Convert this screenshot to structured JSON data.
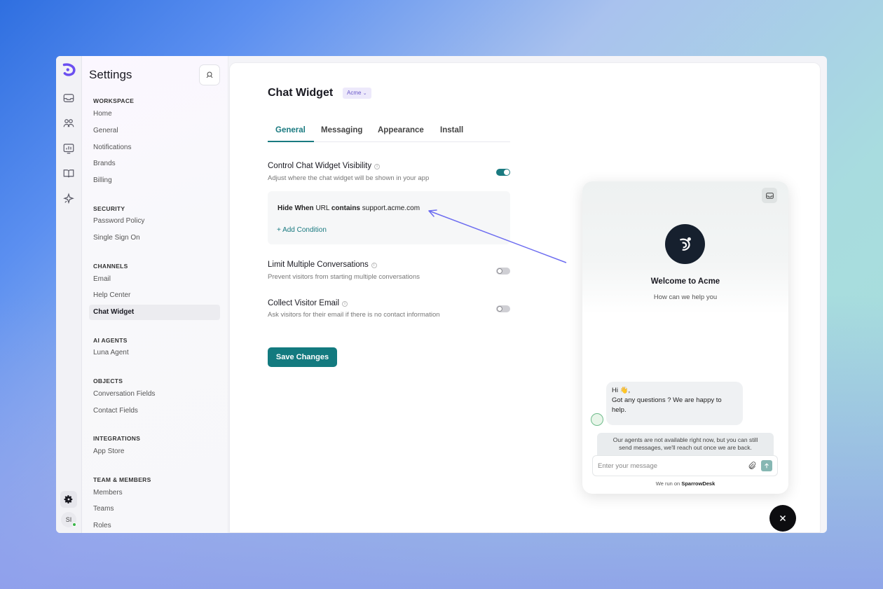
{
  "sidebar": {
    "title": "Settings",
    "sections": {
      "workspace": {
        "label": "WORKSPACE",
        "items": [
          "Home",
          "General",
          "Notifications",
          "Brands",
          "Billing"
        ]
      },
      "security": {
        "label": "SECURITY",
        "items": [
          "Password Policy",
          "Single Sign On"
        ]
      },
      "channels": {
        "label": "CHANNELS",
        "items": [
          "Email",
          "Help Center",
          "Chat Widget"
        ]
      },
      "ai_agents": {
        "label": "AI AGENTS",
        "items": [
          "Luna Agent"
        ]
      },
      "objects": {
        "label": "OBJECTS",
        "items": [
          "Conversation Fields",
          "Contact Fields"
        ]
      },
      "integrations": {
        "label": "INTEGRATIONS",
        "items": [
          "App Store"
        ]
      },
      "team": {
        "label": "TEAM & MEMBERS",
        "items": [
          "Members",
          "Teams",
          "Roles"
        ]
      }
    },
    "active_item": "Chat Widget"
  },
  "rail": {
    "avatar_initials": "SI"
  },
  "main": {
    "title": "Chat Widget",
    "brand_badge": "Acme",
    "tabs": [
      "General",
      "Messaging",
      "Appearance",
      "Install"
    ],
    "active_tab": "General",
    "visibility": {
      "title": "Control Chat Widget Visibility",
      "desc": "Adjust where the chat widget will be shown in your app",
      "enabled": true
    },
    "condition": {
      "hide_when": "Hide When",
      "field": "URL",
      "operator": "contains",
      "value": "support.acme.com",
      "add_label": "+ Add Condition"
    },
    "limit_conversations": {
      "title": "Limit Multiple Conversations",
      "desc": "Prevent visitors from starting multiple conversations",
      "enabled": false
    },
    "collect_email": {
      "title": "Collect Visitor Email",
      "desc": "Ask visitors for their email if there is no contact information",
      "enabled": false
    },
    "save_label": "Save Changes"
  },
  "widget": {
    "welcome": "Welcome to Acme",
    "help": "How can we help you",
    "bubble_line1": "Hi 👋,",
    "bubble_line2": "Got any questions ? We are happy to",
    "bubble_line3": "help.",
    "notice_line1": "Our agents are not available right now, but you can still",
    "notice_line2": "send messages, we'll reach out once we are back.",
    "input_placeholder": "Enter your message",
    "footer_prefix": "We run on",
    "footer_brand": "SparrowDesk"
  },
  "colors": {
    "accent": "#137a7f",
    "brand_badge": "#6a58c8",
    "arrow": "#6c6cf0"
  }
}
